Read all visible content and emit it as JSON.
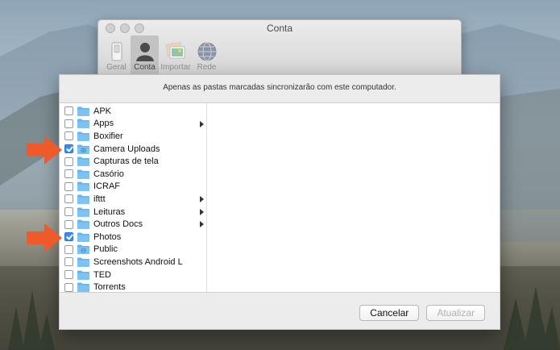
{
  "window": {
    "title": "Conta"
  },
  "toolbar": {
    "items": [
      {
        "label": "Geral",
        "icon": "switch-icon",
        "active": false
      },
      {
        "label": "Conta",
        "icon": "person-icon",
        "active": true
      },
      {
        "label": "Importar",
        "icon": "photos-icon",
        "active": false
      },
      {
        "label": "Rede",
        "icon": "globe-icon",
        "active": false
      }
    ]
  },
  "sheet": {
    "message": "Apenas as pastas marcadas sincronizarão com este computador.",
    "folders": [
      {
        "name": "APK",
        "checked": false,
        "has_children": false
      },
      {
        "name": "Apps",
        "checked": false,
        "has_children": true
      },
      {
        "name": "Boxifier",
        "checked": false,
        "has_children": false
      },
      {
        "name": "Camera Uploads",
        "checked": true,
        "has_children": false,
        "badge": "camera"
      },
      {
        "name": "Capturas de tela",
        "checked": false,
        "has_children": false
      },
      {
        "name": "Casório",
        "checked": false,
        "has_children": false
      },
      {
        "name": "ICRAF",
        "checked": false,
        "has_children": false
      },
      {
        "name": "ifttt",
        "checked": false,
        "has_children": true
      },
      {
        "name": "Leituras",
        "checked": false,
        "has_children": true
      },
      {
        "name": "Outros Docs",
        "checked": false,
        "has_children": true
      },
      {
        "name": "Photos",
        "checked": true,
        "has_children": false
      },
      {
        "name": "Public",
        "checked": false,
        "has_children": false,
        "badge": "globe"
      },
      {
        "name": "Screenshots Android L",
        "checked": false,
        "has_children": false
      },
      {
        "name": "TED",
        "checked": false,
        "has_children": false
      },
      {
        "name": "Torrents",
        "checked": false,
        "has_children": false
      }
    ],
    "cancel_label": "Cancelar",
    "update_label": "Atualizar"
  },
  "colors": {
    "accent": "#3b8cf0",
    "folder": "#6ab4ea",
    "arrow": "#f05a2a"
  }
}
